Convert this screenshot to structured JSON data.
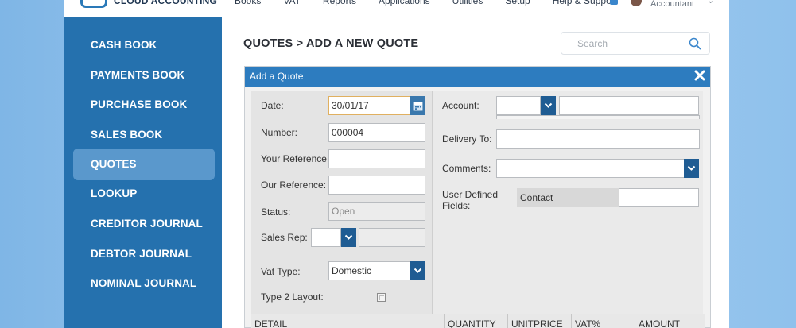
{
  "app": {
    "logo_text": "CLOUD ACCOUNTING",
    "menu": [
      "Books",
      "VAT",
      "Reports",
      "Applications",
      "Utilities",
      "Setup",
      "Help & Support"
    ],
    "user_role": "Accountant"
  },
  "sidebar": {
    "items": [
      {
        "label": "CASH BOOK",
        "active": false
      },
      {
        "label": "PAYMENTS BOOK",
        "active": false
      },
      {
        "label": "PURCHASE BOOK",
        "active": false
      },
      {
        "label": "SALES BOOK",
        "active": false
      },
      {
        "label": "QUOTES",
        "active": true
      },
      {
        "label": "LOOKUP",
        "active": false
      },
      {
        "label": "CREDITOR JOURNAL",
        "active": false
      },
      {
        "label": "DEBTOR JOURNAL",
        "active": false
      },
      {
        "label": "NOMINAL JOURNAL",
        "active": false
      }
    ]
  },
  "page": {
    "title": "QUOTES > ADD A NEW QUOTE",
    "search_placeholder": "Search"
  },
  "dialog": {
    "title": "Add a Quote",
    "left": {
      "date_label": "Date:",
      "date_value": "30/01/17",
      "number_label": "Number:",
      "number_value": "000004",
      "your_ref_label": "Your Reference:",
      "your_ref_value": "",
      "our_ref_label": "Our Reference:",
      "our_ref_value": "",
      "status_label": "Status:",
      "status_value": "Open",
      "sales_rep_label": "Sales Rep:",
      "vat_type_label": "Vat Type:",
      "vat_type_value": "Domestic",
      "type2_label": "Type 2 Layout:",
      "type2_checked": false
    },
    "right": {
      "account_label": "Account:",
      "delivery_label": "Delivery To:",
      "comments_label": "Comments:",
      "udf_label_line1": "User Defined",
      "udf_label_line2": "Fields:",
      "contact_label": "Contact"
    },
    "grid_headers": [
      "DETAIL",
      "QUANTITY",
      "UNITPRICE",
      "VAT%",
      "AMOUNT"
    ]
  },
  "colors": {
    "sidebar_bg": "#2571ae",
    "sidebar_active": "#5a98cc",
    "dialog_header": "#2d7cbf",
    "dropdown_button": "#1f5c93"
  }
}
